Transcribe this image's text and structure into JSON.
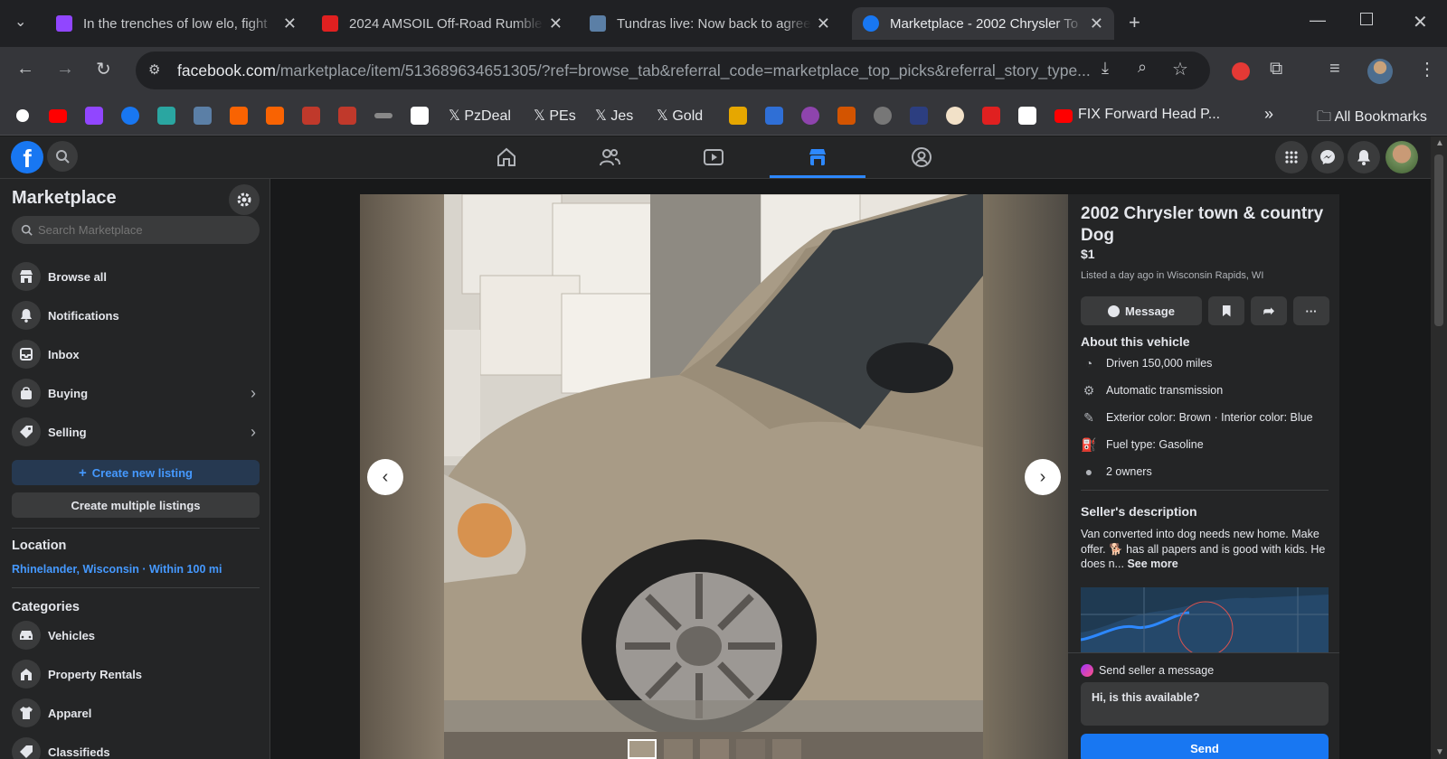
{
  "browser": {
    "tabs": [
      {
        "title": "In the trenches of low elo, fight",
        "favicon_color": "#9146ff"
      },
      {
        "title": "2024 AMSOIL Off-Road Rumble",
        "favicon_color": "#e02020"
      },
      {
        "title": "Tundras live: Now back to agree",
        "favicon_color": "#5b7fa6"
      },
      {
        "title": "Marketplace - 2002 Chrysler To",
        "favicon_color": "#1877f2"
      }
    ],
    "url_host": "facebook.com",
    "url_path": "/marketplace/item/513689634651305/?ref=browse_tab&referral_code=marketplace_top_picks&referral_story_type...",
    "bookmarks": [
      "PzDeal",
      "PEs",
      "Jes",
      "Gold",
      "FIX Forward Head P..."
    ],
    "all_bookmarks": "All Bookmarks"
  },
  "sidebar": {
    "title": "Marketplace",
    "search_placeholder": "Search Marketplace",
    "items": [
      {
        "label": "Browse all"
      },
      {
        "label": "Notifications"
      },
      {
        "label": "Inbox"
      },
      {
        "label": "Buying"
      },
      {
        "label": "Selling"
      }
    ],
    "create_listing": "Create new listing",
    "create_multiple": "Create multiple listings",
    "location_heading": "Location",
    "location_value": "Rhinelander, Wisconsin · Within 100 mi",
    "categories_heading": "Categories",
    "categories": [
      {
        "label": "Vehicles"
      },
      {
        "label": "Property Rentals"
      },
      {
        "label": "Apparel"
      },
      {
        "label": "Classifieds"
      }
    ]
  },
  "listing": {
    "title": "2002 Chrysler town & country Dog",
    "price": "$1",
    "listed": "Listed a day ago in Wisconsin Rapids, WI",
    "message_button": "Message",
    "about_heading": "About this vehicle",
    "specs": [
      {
        "text": "Driven 150,000 miles",
        "icon": "speedometer-icon"
      },
      {
        "text": "Automatic transmission",
        "icon": "transmission-icon"
      },
      {
        "text": "Exterior color: Brown · Interior color: Blue",
        "icon": "paint-icon"
      },
      {
        "text": "Fuel type: Gasoline",
        "icon": "fuel-icon"
      },
      {
        "text": "2 owners",
        "icon": "person-icon"
      }
    ],
    "desc_heading": "Seller's description",
    "description": "Van converted into dog needs new home. Make offer. 🐕 has all papers and is good with kids. He does n...",
    "see_more": "See more",
    "send_heading": "Send seller a message",
    "message_value": "Hi, is this available?",
    "send_button": "Send"
  },
  "colors": {
    "accent": "#1877f2",
    "link": "#4599ff",
    "panel": "#242526"
  }
}
